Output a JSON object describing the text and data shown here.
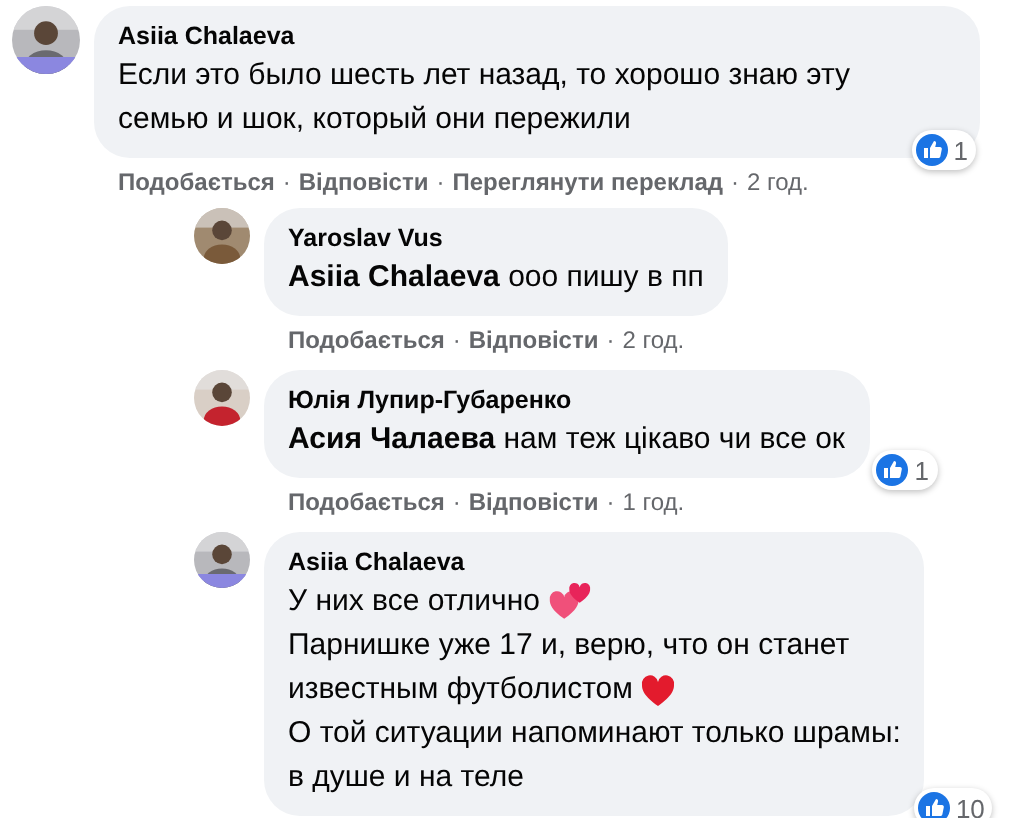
{
  "separator": "·",
  "comments": [
    {
      "author": "Asiia Chalaeva",
      "lines": [
        {
          "text": "Если это было шесть лет назад, то хорошо знаю эту"
        },
        {
          "text": "семью и шок, который они пережили"
        }
      ],
      "reactions": "1",
      "actions": [
        {
          "text": "Подобається",
          "kind": "link"
        },
        {
          "text": "Відповісти",
          "kind": "link"
        },
        {
          "text": "Переглянути переклад",
          "kind": "link"
        },
        {
          "text": "2 год.",
          "kind": "time"
        }
      ],
      "replies": [
        {
          "author": "Yaroslav Vus",
          "lines": [
            {
              "text": "**Asiia Chalaeva** ооо пишу в пп"
            }
          ],
          "actions": [
            {
              "text": "Подобається",
              "kind": "link"
            },
            {
              "text": "Відповісти",
              "kind": "link"
            },
            {
              "text": "2 год.",
              "kind": "time"
            }
          ]
        },
        {
          "author": "Юлія Лупир-Губаренко",
          "lines": [
            {
              "text": "**Асия Чалаева** нам теж цікаво чи все ок"
            }
          ],
          "reactions": "1",
          "actions": [
            {
              "text": "Подобається",
              "kind": "link"
            },
            {
              "text": "Відповісти",
              "kind": "link"
            },
            {
              "text": "1 год.",
              "kind": "time"
            }
          ]
        },
        {
          "author": "Asiia Chalaeva",
          "lines": [
            {
              "text": "У них все отлично",
              "kind": "hearts"
            },
            {
              "text": "Парнишке уже 17 и, верю, что он станет"
            },
            {
              "text": "известным футболистом",
              "kind": "heart"
            },
            {
              "text": "О той ситуации напоминают только шрамы:"
            },
            {
              "text": "в душе и на теле"
            }
          ],
          "reactions": "10"
        }
      ]
    }
  ]
}
